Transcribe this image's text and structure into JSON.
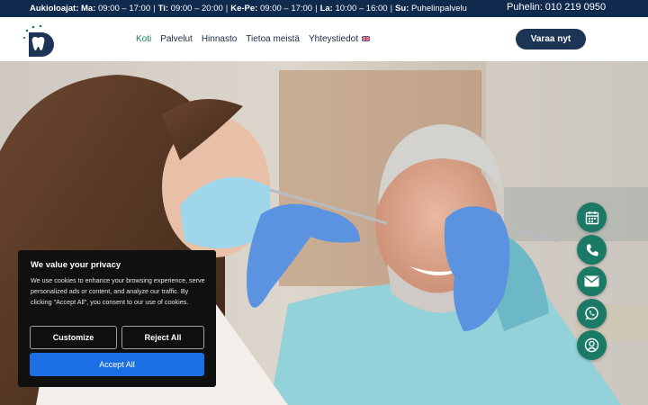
{
  "topbar": {
    "hours": [
      {
        "day": "Aukioloajat: Ma:",
        "time": "09:00 – 17:00"
      },
      {
        "day": "Ti:",
        "time": "09:00 – 20:00"
      },
      {
        "day": "Ke-Pe:",
        "time": "09:00 – 17:00"
      },
      {
        "day": "La:",
        "time": "10:00 – 16:00"
      },
      {
        "day": "Su:",
        "time": "Puhelinpalvelu"
      }
    ],
    "phone": "Puhelin: 010 219 0950"
  },
  "nav": {
    "items": [
      "Koti",
      "Palvelut",
      "Hinnasto",
      "Tietoa meistä",
      "Yhteystiedot"
    ],
    "book_label": "Varaa nyt"
  },
  "cookie": {
    "title": "We value your privacy",
    "text": "We use cookies to enhance your browsing experience, serve personalized ads or content, and analyze our traffic. By clicking \"Accept All\", you consent to our use of cookies.",
    "customize": "Customize",
    "reject": "Reject All",
    "accept": "Accept All"
  },
  "floating_buttons": [
    "calendar-icon",
    "phone-icon",
    "mail-icon",
    "whatsapp-icon",
    "user-support-icon"
  ],
  "colors": {
    "topbar": "#0f2a4d",
    "nav_active": "#1f7a68",
    "book_button": "#1c3557",
    "fab": "#1b7a66",
    "accept": "#1b6fe5"
  }
}
